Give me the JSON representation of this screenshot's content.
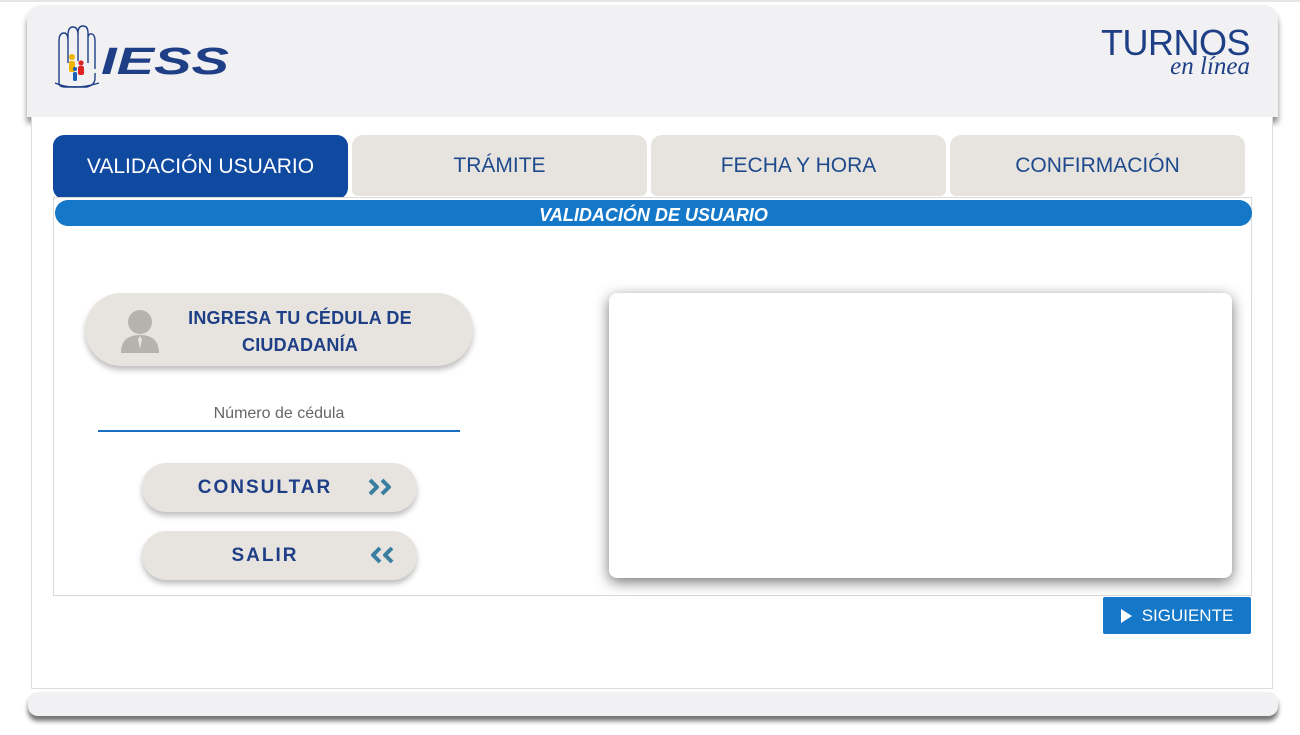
{
  "header": {
    "logo_text": "IESS",
    "brand_title": "TURNOS",
    "brand_subtitle": "en línea"
  },
  "tabs": [
    {
      "label": "VALIDACIÓN USUARIO",
      "active": true
    },
    {
      "label": "TRÁMITE",
      "active": false
    },
    {
      "label": "FECHA Y HORA",
      "active": false
    },
    {
      "label": "CONFIRMACIÓN",
      "active": false
    }
  ],
  "panel": {
    "title": "VALIDACIÓN DE USUARIO",
    "id_card_label": "INGRESA TU CÉDULA DE CIUDADANÍA",
    "cedula_placeholder": "Número de cédula",
    "cedula_value": ""
  },
  "buttons": {
    "consultar": "CONSULTAR",
    "salir": "SALIR",
    "siguiente": "SIGUIENTE"
  },
  "icons": {
    "avatar": "user-silhouette-icon",
    "consultar": "double-chevron-right-icon",
    "salir": "double-chevron-left-icon",
    "siguiente": "play-icon"
  },
  "colors": {
    "primary_dark": "#0f4aa0",
    "primary": "#1477c8",
    "text_blue": "#1e3f86",
    "chevron": "#3b7fa0",
    "pill_bg": "#e7e4e0"
  }
}
